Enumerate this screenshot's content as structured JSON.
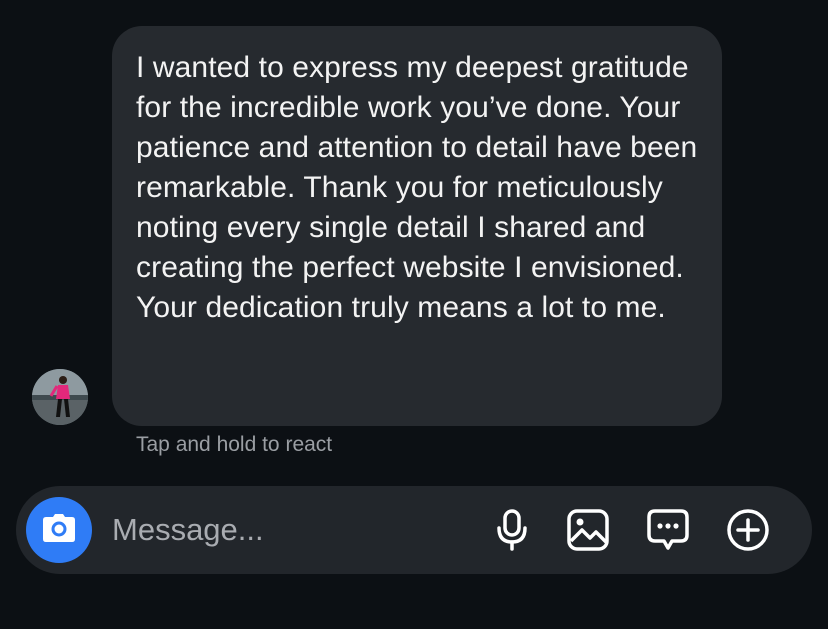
{
  "message": {
    "text": "I wanted to express my deepest gratitude for the incredible work you’ve done. Your patience and attention to detail have been remarkable. Thank you for meticulously noting every single detail I shared and creating the perfect website I envisioned. Your dedication truly means a lot to me."
  },
  "hint": "Tap and hold to react",
  "composer": {
    "placeholder": "Message...",
    "camera_icon": "camera-icon",
    "tools": [
      "microphone-icon",
      "photo-icon",
      "sticker-icon",
      "plus-icon"
    ]
  },
  "colors": {
    "background": "#0c1014",
    "bubble": "#262a2f",
    "composer": "#22262b",
    "accent": "#2f7cf6",
    "hint_text": "#9a9ea3"
  }
}
